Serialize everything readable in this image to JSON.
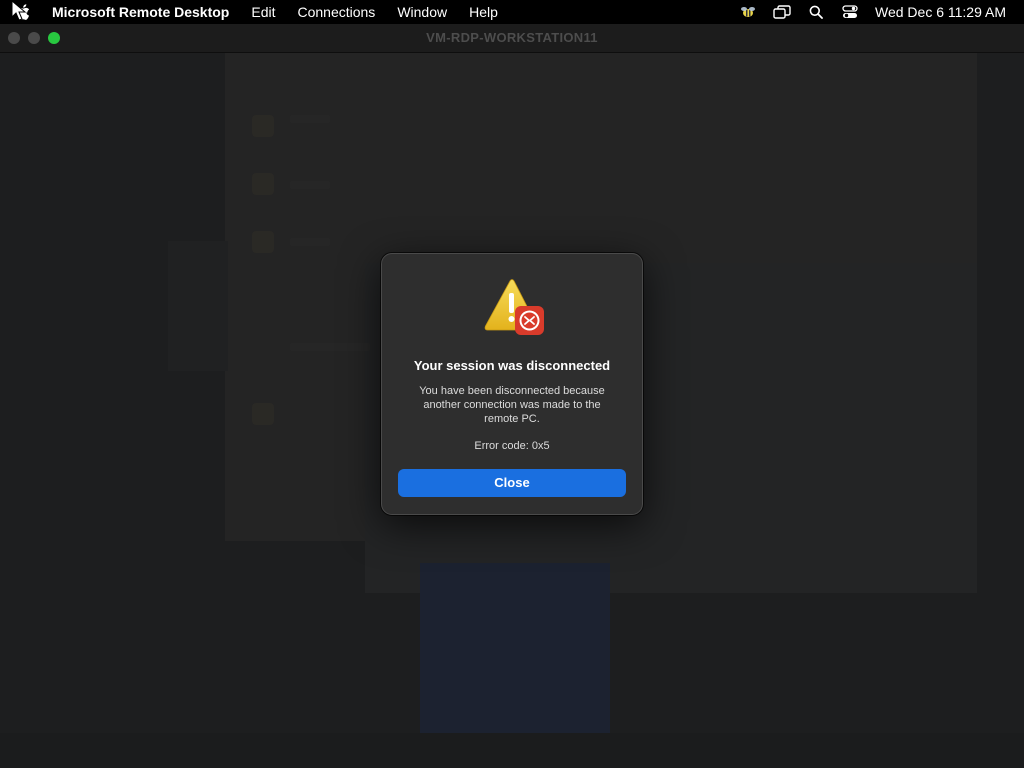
{
  "menubar": {
    "app_name": "Microsoft Remote Desktop",
    "items": [
      "Edit",
      "Connections",
      "Window",
      "Help"
    ],
    "status_icons": [
      "bee-icon",
      "screen-mirroring-icon",
      "search-icon",
      "control-center-icon"
    ],
    "clock": "Wed Dec 6  11:29 AM"
  },
  "window": {
    "title": "VM-RDP-WORKSTATION11"
  },
  "dialog": {
    "title": "Your session was disconnected",
    "message": "You have been disconnected because another connection was made to the remote PC.",
    "error": "Error code: 0x5",
    "close_label": "Close",
    "icon": "warning-remote-desktop-icon",
    "accent_color": "#1a6fe0"
  }
}
